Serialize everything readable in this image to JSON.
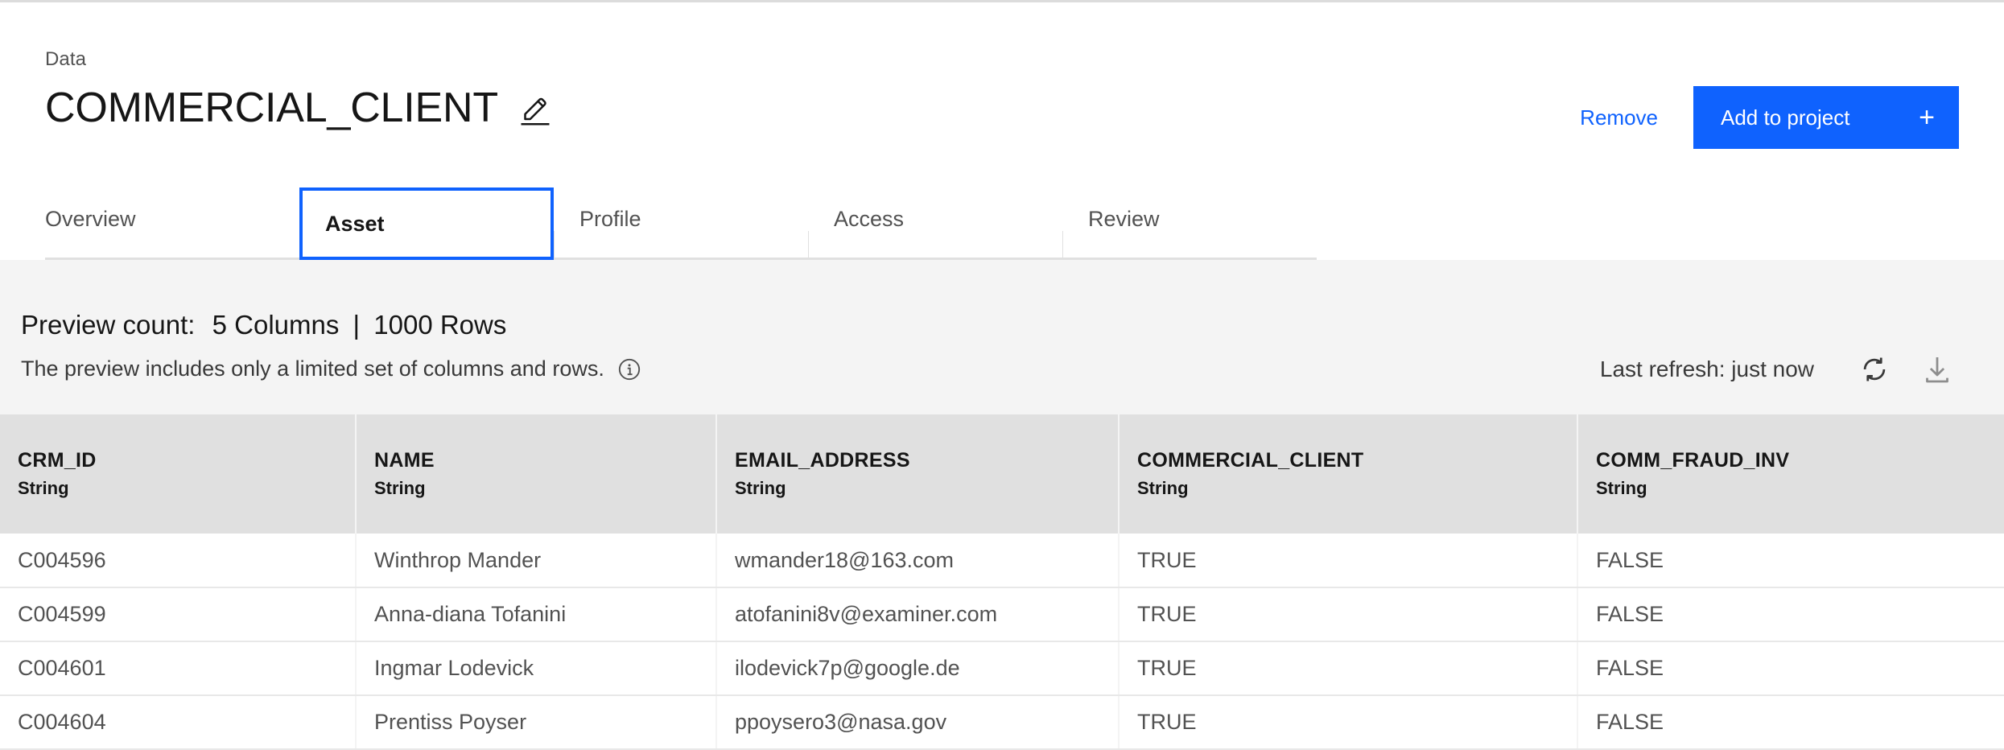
{
  "header": {
    "breadcrumb": "Data",
    "title": "COMMERCIAL_CLIENT",
    "edit_icon": "pencil-edit-icon",
    "remove_label": "Remove",
    "add_to_project_label": "Add to project",
    "add_to_project_icon": "plus-icon",
    "accent_color": "#0f62fe"
  },
  "tabs": [
    {
      "label": "Overview",
      "selected": false
    },
    {
      "label": "Asset",
      "selected": true
    },
    {
      "label": "Profile",
      "selected": false
    },
    {
      "label": "Access",
      "selected": false
    },
    {
      "label": "Review",
      "selected": false
    }
  ],
  "preview": {
    "count_label": "Preview count:",
    "columns_text": "5 Columns",
    "separator": "|",
    "rows_text": "1000 Rows",
    "columns_count": 5,
    "rows_count": 1000,
    "subtitle": "The preview includes only a limited set of columns and rows.",
    "info_icon": "info-icon",
    "last_refresh": "Last refresh: just now",
    "refresh_icon": "refresh-icon",
    "download_icon": "download-icon",
    "background_color": "#f4f4f4"
  },
  "table": {
    "header_background": "#e0e0e0",
    "columns": [
      {
        "name": "CRM_ID",
        "type": "String"
      },
      {
        "name": "NAME",
        "type": "String"
      },
      {
        "name": "EMAIL_ADDRESS",
        "type": "String"
      },
      {
        "name": "COMMERCIAL_CLIENT",
        "type": "String"
      },
      {
        "name": "COMM_FRAUD_INV",
        "type": "String"
      }
    ],
    "rows": [
      [
        "C004596",
        "Winthrop Mander",
        "wmander18@163.com",
        "TRUE",
        "FALSE"
      ],
      [
        "C004599",
        "Anna-diana Tofanini",
        "atofanini8v@examiner.com",
        "TRUE",
        "FALSE"
      ],
      [
        "C004601",
        "Ingmar Lodevick",
        "ilodevick7p@google.de",
        "TRUE",
        "FALSE"
      ],
      [
        "C004604",
        "Prentiss Poyser",
        "ppoysero3@nasa.gov",
        "TRUE",
        "FALSE"
      ]
    ]
  }
}
